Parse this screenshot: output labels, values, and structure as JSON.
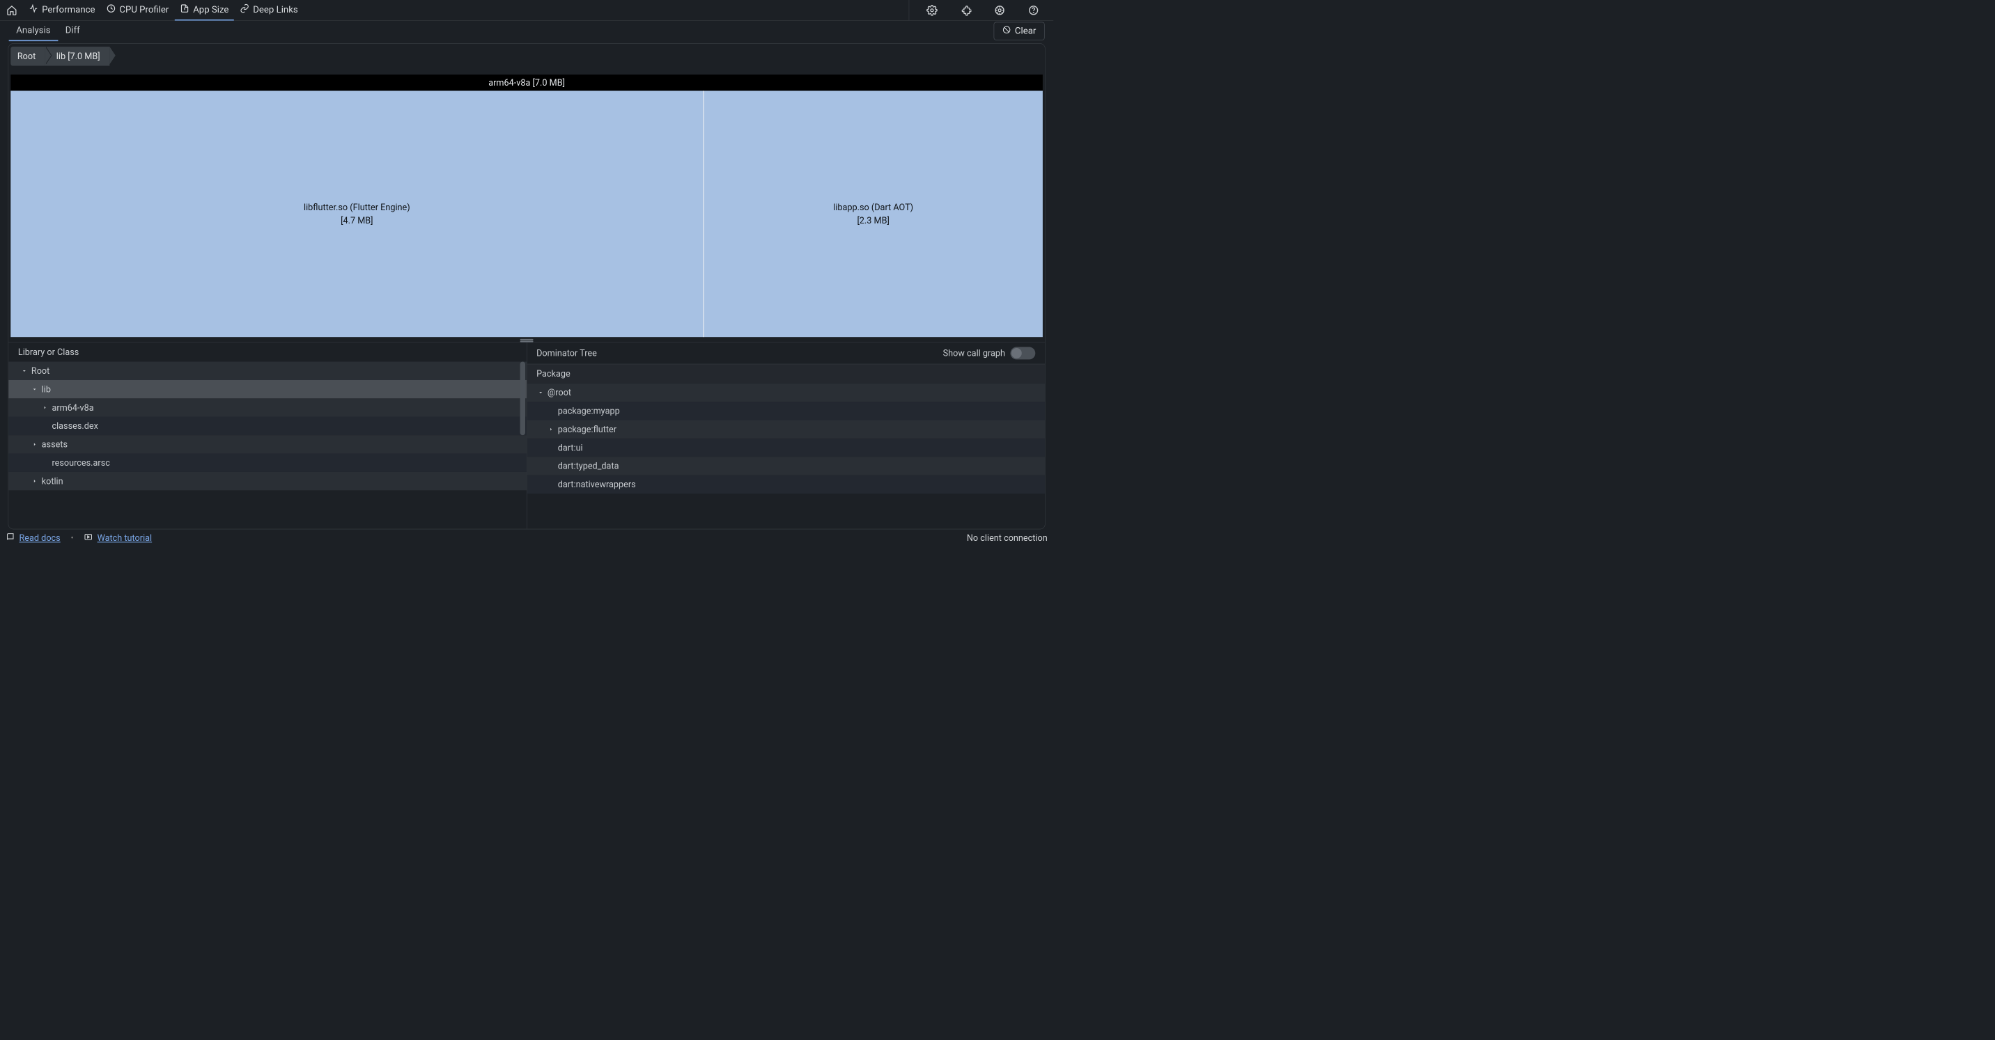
{
  "topnav": {
    "items": [
      {
        "label": "Performance"
      },
      {
        "label": "CPU Profiler"
      },
      {
        "label": "App Size"
      },
      {
        "label": "Deep Links"
      }
    ],
    "active": 2
  },
  "subtabs": {
    "items": [
      "Analysis",
      "Diff"
    ],
    "active": 0,
    "clear_label": "Clear"
  },
  "breadcrumb": [
    "Root",
    "lib [7.0 MB]"
  ],
  "treemap": {
    "header": "arm64-v8a [7.0 MB]",
    "cells": [
      {
        "title": "libflutter.so (Flutter Engine)",
        "size_label": "[4.7 MB]",
        "flex": 4.7
      },
      {
        "title": "libapp.so (Dart AOT)",
        "size_label": "[2.3 MB]",
        "flex": 2.3
      }
    ]
  },
  "left_table": {
    "header": "Library or Class",
    "rows": [
      {
        "label": "Root",
        "indent": 0,
        "expander": "down",
        "tone": "odd"
      },
      {
        "label": "lib",
        "indent": 1,
        "expander": "down",
        "tone": "selected"
      },
      {
        "label": "arm64-v8a",
        "indent": 2,
        "expander": "right",
        "tone": "odd"
      },
      {
        "label": "classes.dex",
        "indent": 2,
        "expander": "none",
        "tone": "even"
      },
      {
        "label": "assets",
        "indent": 1,
        "expander": "right",
        "tone": "odd"
      },
      {
        "label": "resources.arsc",
        "indent": 2,
        "expander": "none",
        "tone": "even"
      },
      {
        "label": "kotlin",
        "indent": 1,
        "expander": "right",
        "tone": "odd"
      }
    ]
  },
  "right_table": {
    "header": "Dominator Tree",
    "toggle_label": "Show call graph",
    "sub_header": "Package",
    "rows": [
      {
        "label": "@root",
        "indent": 0,
        "expander": "down",
        "tone": "odd"
      },
      {
        "label": "package:myapp",
        "indent": 1,
        "expander": "none",
        "tone": "even"
      },
      {
        "label": "package:flutter",
        "indent": 1,
        "expander": "right",
        "tone": "odd"
      },
      {
        "label": "dart:ui",
        "indent": 1,
        "expander": "none",
        "tone": "even"
      },
      {
        "label": "dart:typed_data",
        "indent": 1,
        "expander": "none",
        "tone": "odd"
      },
      {
        "label": "dart:nativewrappers",
        "indent": 1,
        "expander": "none",
        "tone": "even"
      }
    ]
  },
  "footer": {
    "read_docs": "Read docs",
    "watch_tutorial": "Watch tutorial",
    "status": "No client connection"
  }
}
